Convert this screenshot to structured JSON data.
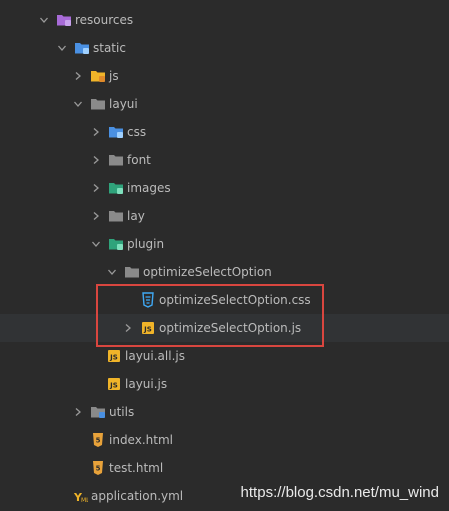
{
  "colors": {
    "background": "#2b2b2b",
    "row_highlight": "#313335",
    "text": "#bbbbbb",
    "highlight_box": "#d9463f",
    "folder": "#8a8a8a",
    "resources_folder": "#a86bd8",
    "static_folder": "#4a90e2",
    "js_file": "#f0b429",
    "html_file": "#e8a23a",
    "css_file": "#3fa9f5"
  },
  "tree": {
    "items": [
      {
        "label": "resources",
        "arrow": "down",
        "icon": "resources-folder-icon"
      },
      {
        "label": "static",
        "arrow": "down",
        "icon": "static-folder-icon"
      },
      {
        "label": "js",
        "arrow": "right",
        "icon": "js-folder-icon"
      },
      {
        "label": "layui",
        "arrow": "down",
        "icon": "folder-icon"
      },
      {
        "label": "css",
        "arrow": "right",
        "icon": "css-folder-icon"
      },
      {
        "label": "font",
        "arrow": "right",
        "icon": "font-folder-icon"
      },
      {
        "label": "images",
        "arrow": "right",
        "icon": "images-folder-icon"
      },
      {
        "label": "lay",
        "arrow": "right",
        "icon": "folder-icon"
      },
      {
        "label": "plugin",
        "arrow": "down",
        "icon": "plugin-folder-icon"
      },
      {
        "label": "optimizeSelectOption",
        "arrow": "down",
        "icon": "folder-icon"
      },
      {
        "label": "optimizeSelectOption.css",
        "arrow": "none",
        "icon": "css-file-icon"
      },
      {
        "label": "optimizeSelectOption.js",
        "arrow": "right",
        "icon": "js-file-icon"
      },
      {
        "label": "layui.all.js",
        "arrow": "none",
        "icon": "js-file-icon"
      },
      {
        "label": "layui.js",
        "arrow": "none",
        "icon": "js-file-icon"
      },
      {
        "label": "utils",
        "arrow": "right",
        "icon": "utils-folder-icon"
      },
      {
        "label": "index.html",
        "arrow": "none",
        "icon": "html-file-icon"
      },
      {
        "label": "test.html",
        "arrow": "none",
        "icon": "html-file-icon"
      },
      {
        "label": "application.yml",
        "arrow": "none",
        "icon": "yml-file-icon"
      }
    ]
  },
  "watermark": "https://blog.csdn.net/mu_wind"
}
